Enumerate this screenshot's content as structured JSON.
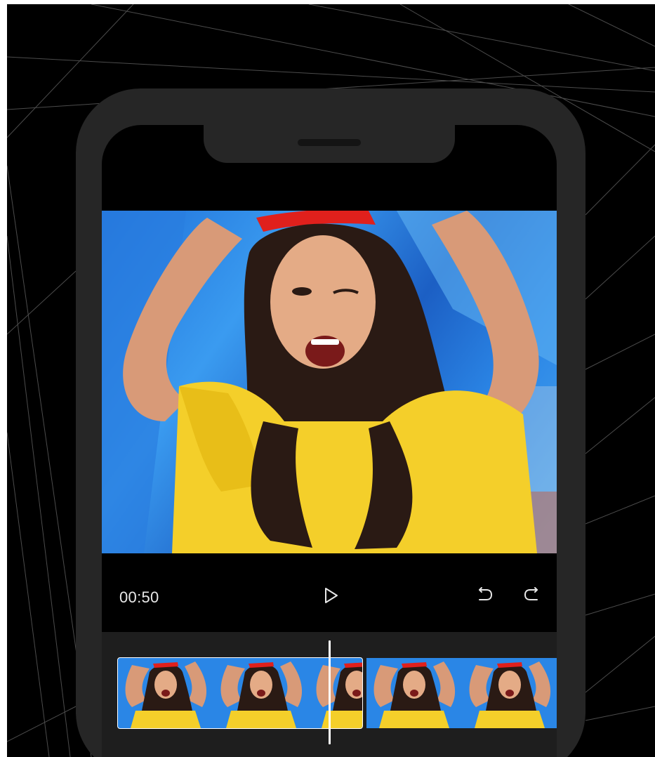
{
  "player": {
    "current_time": "00:50",
    "play_icon": "play-icon",
    "undo_icon": "undo-icon",
    "redo_icon": "redo-icon"
  },
  "timeline": {
    "clips": [
      {
        "selected": true,
        "thumbnails": 3
      },
      {
        "selected": false,
        "thumbnails": 2
      }
    ]
  },
  "colors": {
    "background": "#000000",
    "phone_frame": "#262626",
    "timeline_bg": "#1e1e1e",
    "accent_white": "#ffffff"
  }
}
